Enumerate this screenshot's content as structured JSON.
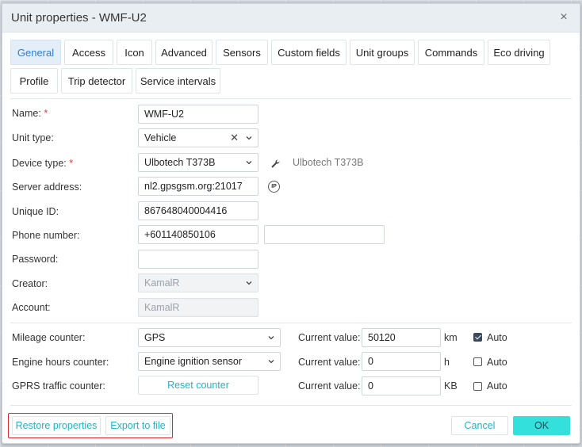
{
  "dialog": {
    "title": "Unit properties - WMF-U2",
    "close_glyph": "×"
  },
  "tabs": [
    {
      "label": "General",
      "active": true
    },
    {
      "label": "Access"
    },
    {
      "label": "Icon"
    },
    {
      "label": "Advanced"
    },
    {
      "label": "Sensors"
    },
    {
      "label": "Custom fields"
    },
    {
      "label": "Unit groups"
    },
    {
      "label": "Commands"
    },
    {
      "label": "Eco driving"
    },
    {
      "label": "Profile"
    },
    {
      "label": "Trip detector"
    },
    {
      "label": "Service intervals"
    }
  ],
  "fields": {
    "name": {
      "label": "Name:",
      "required_mark": "*",
      "value": "WMF-U2"
    },
    "unit_type": {
      "label": "Unit type:",
      "value": "Vehicle"
    },
    "device_type": {
      "label": "Device type:",
      "required_mark": "*",
      "value": "Ulbotech T373B",
      "hint": "Ulbotech T373B",
      "icon": "wrench-icon"
    },
    "server_address": {
      "label": "Server address:",
      "value": "nl2.gpsgsm.org:21017",
      "icon": "ip-icon",
      "icon_text": "IP"
    },
    "unique_id": {
      "label": "Unique ID:",
      "value": "867648040004416"
    },
    "phone_number": {
      "label": "Phone number:",
      "value": "+601140850106",
      "second_value": ""
    },
    "password": {
      "label": "Password:",
      "value": ""
    },
    "creator": {
      "label": "Creator:",
      "value": "KamalR"
    },
    "account": {
      "label": "Account:",
      "value": "KamalR"
    }
  },
  "counters": {
    "current_value_label": "Current value:",
    "auto_label": "Auto",
    "mileage": {
      "label": "Mileage counter:",
      "select": "GPS",
      "value": "50120",
      "unit": "km",
      "auto": true
    },
    "engine_hours": {
      "label": "Engine hours counter:",
      "select": "Engine ignition sensor",
      "value": "0",
      "unit": "h",
      "auto": false
    },
    "gprs": {
      "label": "GPRS traffic counter:",
      "button": "Reset counter",
      "value": "0",
      "unit": "KB",
      "auto": false
    }
  },
  "footer": {
    "restore": "Restore properties",
    "export": "Export to file",
    "cancel": "Cancel",
    "ok": "OK"
  },
  "colors": {
    "accent": "#2f7fd0",
    "link": "#22b3c5",
    "ok_button": "#33e0dc",
    "highlight": "#d72b2b"
  }
}
